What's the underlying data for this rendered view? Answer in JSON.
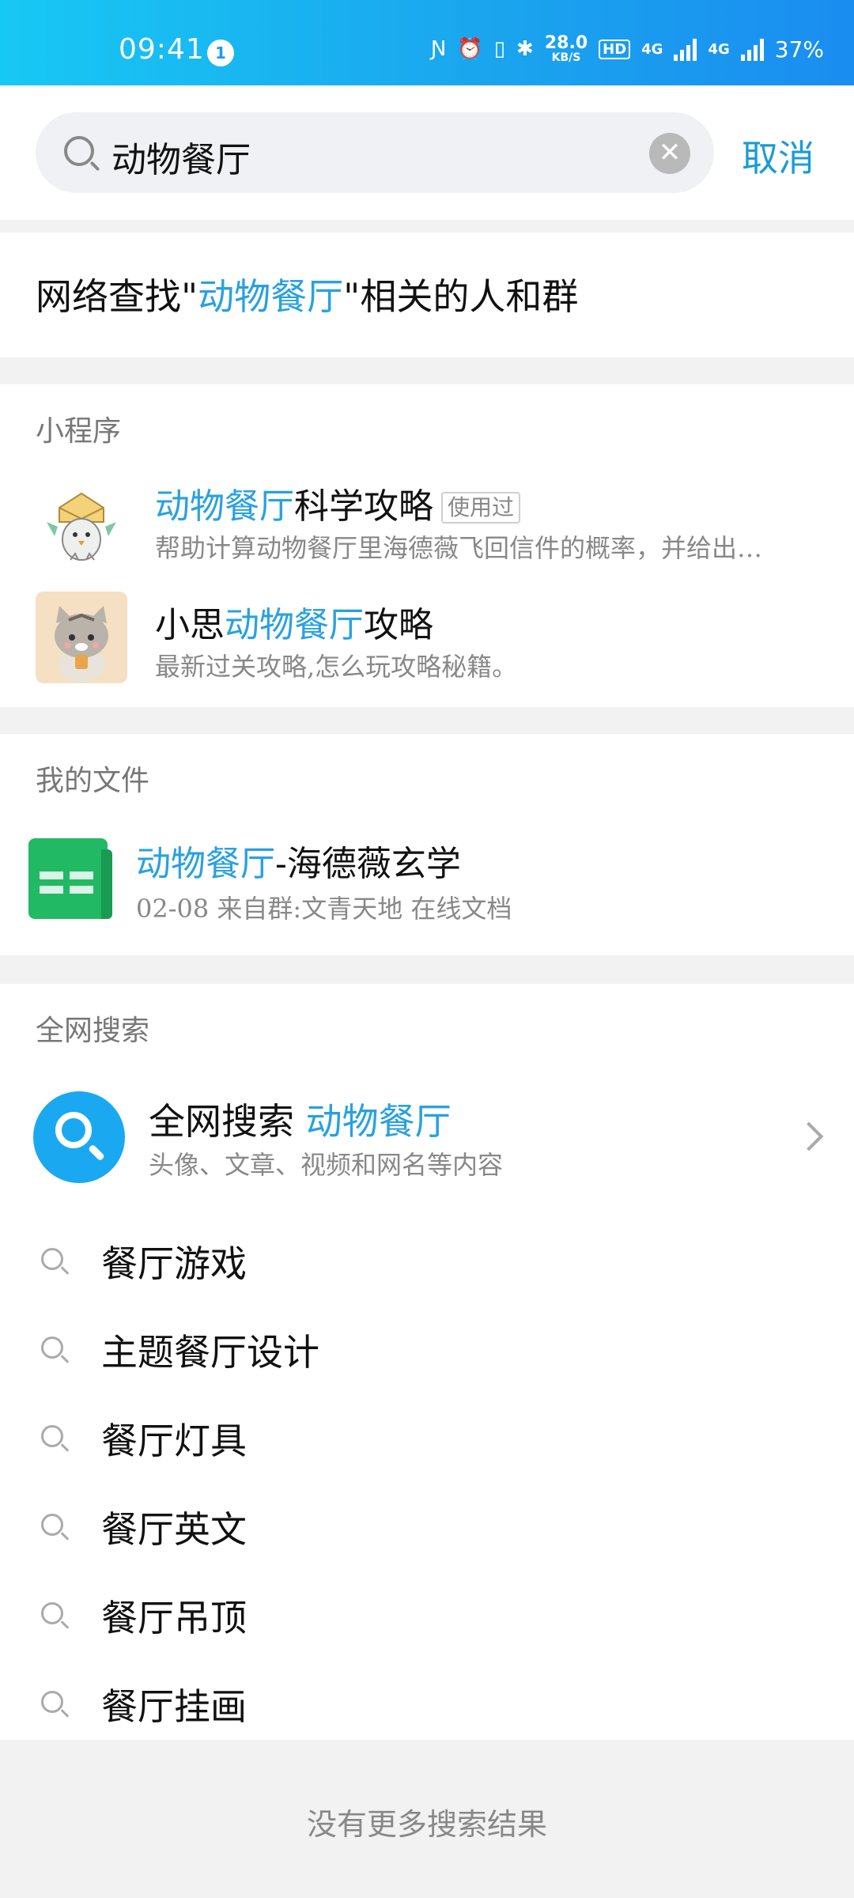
{
  "status_bar": {
    "time": "09:41",
    "notification_count": "1",
    "net_speed_value": "28.0",
    "net_speed_unit": "KB/S",
    "hd_label": "HD",
    "net1": "4G",
    "net2": "4G",
    "battery": "37%"
  },
  "search": {
    "query": "动物餐厅",
    "cancel_label": "取消"
  },
  "network_find": {
    "prefix": "网络查找\"",
    "keyword": "动物餐厅",
    "suffix": "\"相关的人和群"
  },
  "mini_programs": {
    "section_title": "小程序",
    "items": [
      {
        "title_highlight": "动物餐厅",
        "title_rest": "科学攻略",
        "tag": "使用过",
        "subtitle": "帮助计算动物餐厅里海德薇飞回信件的概率，并给出…"
      },
      {
        "title_prefix": "小思",
        "title_highlight": "动物餐厅",
        "title_rest": "攻略",
        "subtitle": "最新过关攻略,怎么玩攻略秘籍。"
      }
    ]
  },
  "my_files": {
    "section_title": "我的文件",
    "file": {
      "title_highlight": "动物餐厅",
      "title_rest": "-海德薇玄学",
      "subtitle": "02-08  来自群:文青天地 在线文档"
    }
  },
  "web_search": {
    "section_title": "全网搜索",
    "title_prefix": "全网搜索 ",
    "keyword": "动物餐厅",
    "subtitle": "头像、文章、视频和网名等内容",
    "suggestions": [
      "餐厅游戏",
      "主题餐厅设计",
      "餐厅灯具",
      "餐厅英文",
      "餐厅吊顶",
      "餐厅挂画"
    ]
  },
  "footer_text": "没有更多搜索结果",
  "colors": {
    "highlight": "#29a1e0",
    "status_bar": "#1aa6ee"
  }
}
